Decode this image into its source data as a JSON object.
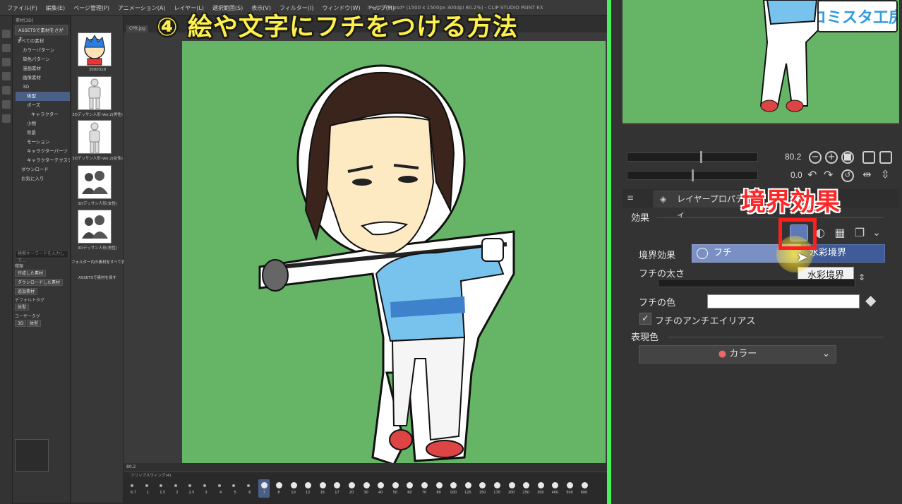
{
  "window": {
    "title_bar": "キャラデザ.psd* (1500 x 1500px 300dpi 80.2%) - CLIP STUDIO PAINT EX",
    "menu": [
      "ファイル(F)",
      "編集(E)",
      "ページ管理(P)",
      "アニメーション(A)",
      "レイヤー(L)",
      "選択範囲(S)",
      "表示(V)",
      "フィルター(I)",
      "ウィンドウ(W)",
      "ヘルプ(H)"
    ]
  },
  "overlay": {
    "video_title": "④ 絵や文字にフチをつける方法",
    "effect_callout": "境界効果",
    "logo": "コミスタ工房"
  },
  "material_panel": {
    "header": "素材[3D]",
    "assets_button": "ASSETSで素材をさがす",
    "tree": [
      "すべての素材",
      "カラーパターン",
      "単色パターン",
      "漫画素材",
      "画像素材",
      "3D",
      "体型",
      "ポーズ",
      "キャラクター",
      "小物",
      "背景",
      "モーション",
      "キャラクターパーツ",
      "キャラクターテクスチャ",
      "ダウンロード",
      "お気に入り"
    ],
    "search_placeholder": "検索キーワードを入力して…",
    "kind_label": "種類",
    "kind_tags": [
      "作成した素材",
      "ダウンロードした素材",
      "追加素材"
    ],
    "default_tag_label": "デフォルトタグ",
    "default_tags": [
      "体型"
    ],
    "user_tag_label": "ユーザータグ",
    "user_tags": [
      "3D",
      "体型"
    ]
  },
  "thumbnails": [
    {
      "caption": "3000318"
    },
    {
      "caption": "3Dデッサン人形-Ver.2(男性)"
    },
    {
      "caption": "3Dデッサン人形-Ver.2(女性)"
    },
    {
      "caption": "3Dデッサン人形(女性)"
    },
    {
      "caption": "3Dデッサン人形(男性)"
    }
  ],
  "thumb_col": {
    "folder_all": "フォルダー内の素材をすべて表示",
    "assets_link": "ASSETSで素材を探す"
  },
  "workspace": {
    "tab_label": "CPR.jpg",
    "status_zoom": "80.2",
    "timeline_label": "フリップスウィング(4)"
  },
  "timeline": {
    "frames": [
      "6.7",
      "1",
      "1.5",
      "2",
      "2.5",
      "3",
      "4",
      "5",
      "6",
      "7",
      "8",
      "10",
      "12",
      "16",
      "17",
      "20",
      "30",
      "40",
      "50",
      "60",
      "70",
      "80",
      "100",
      "120",
      "150",
      "170",
      "200",
      "250",
      "300",
      "400",
      "500",
      "600"
    ],
    "current_index": 9
  },
  "navigator": {
    "zoom_value": "80.2",
    "rotate_value": "0.0"
  },
  "layer_property": {
    "tab_label": "レイヤープロパティ",
    "effect_label": "効果",
    "border_effect_label": "境界効果",
    "option_edge": "フチ",
    "option_watercolor": "水彩境界",
    "tooltip": "水彩境界",
    "edge_width_label": "フチの太さ",
    "edge_color_label": "フチの色",
    "edge_color": "#ffffff",
    "antialias_label": "フチのアンチエイリアス",
    "antialias_checked": true,
    "expression_color_label": "表現色",
    "expression_color_value": "カラー"
  },
  "colors": {
    "canvas_bg": "#66b567",
    "accent_divider": "#47f05a",
    "highlight": "#ff1e1e",
    "title_yellow": "#fff14a"
  }
}
